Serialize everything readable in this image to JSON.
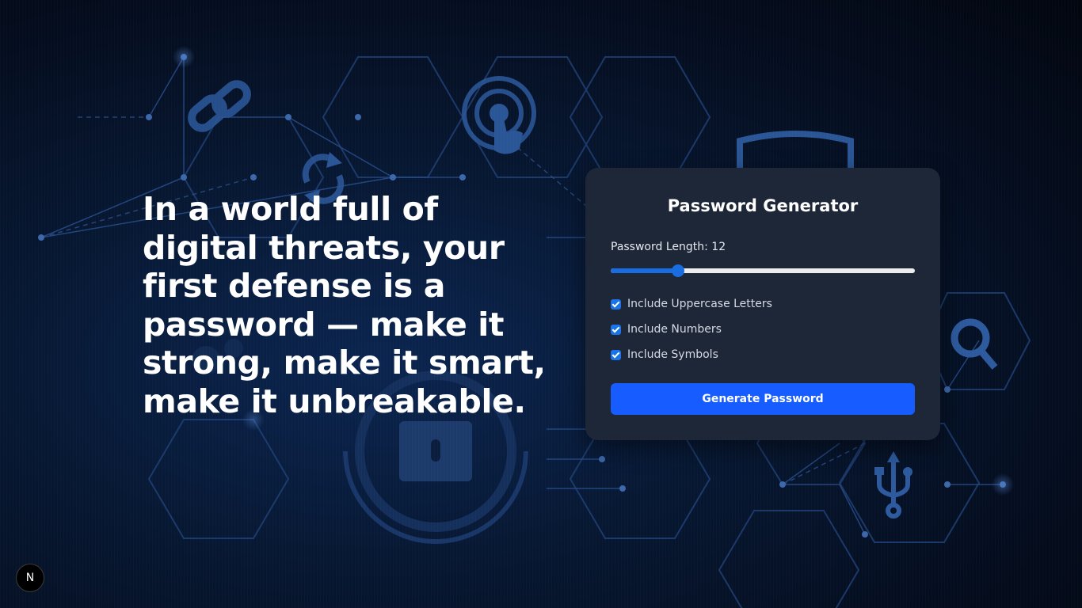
{
  "hero": {
    "headline": "In a world full of digital threats, your first defense is a password — make it strong, make it smart, make it unbreakable."
  },
  "generator": {
    "title": "Password Generator",
    "length_label": "Password Length: 12",
    "length_value": 12,
    "length_min": 4,
    "length_max": 40,
    "options": [
      {
        "label": "Include Uppercase Letters",
        "checked": true
      },
      {
        "label": "Include Numbers",
        "checked": true
      },
      {
        "label": "Include Symbols",
        "checked": true
      }
    ],
    "button_label": "Generate Password"
  },
  "badge": {
    "letter": "N"
  },
  "colors": {
    "accent": "#175cff",
    "card": "#1e2738",
    "background": "#040c1d"
  }
}
